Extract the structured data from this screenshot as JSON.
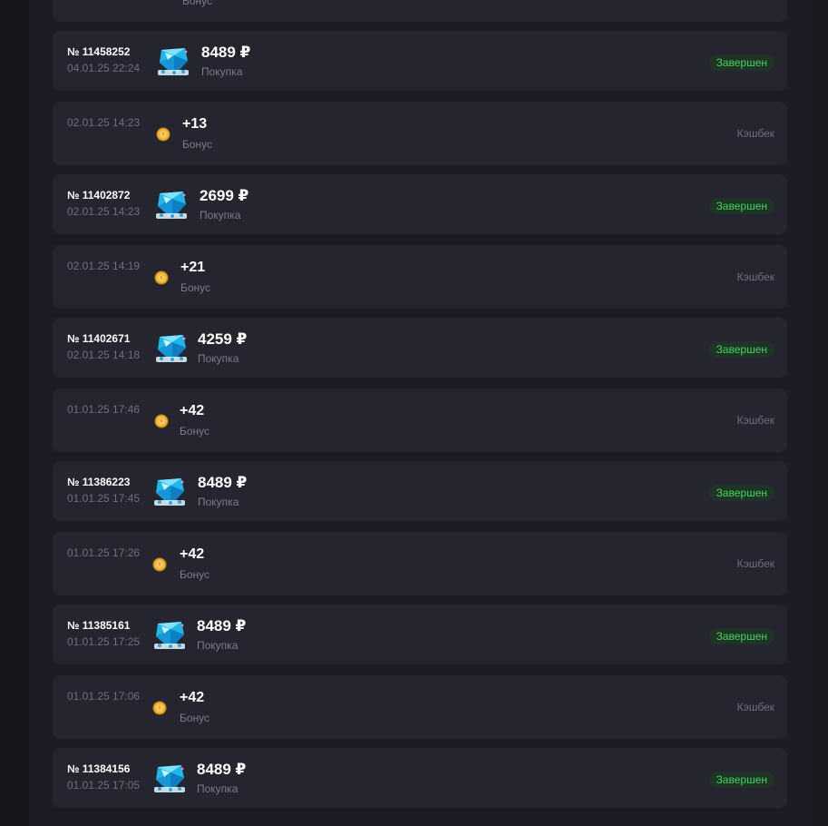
{
  "top_partial": {
    "label": "Бонус"
  },
  "rows": [
    {
      "kind": "purchase",
      "order": "№ 11458252",
      "date": "04.01.25 22:24",
      "amount": "8489 ₽",
      "label": "Покупка",
      "status": "Завершен",
      "icon": "gem-pack-icon"
    },
    {
      "kind": "bonus",
      "date": "02.01.25 14:23",
      "amount": "+13",
      "label": "Бонус",
      "status": "Кэшбек",
      "icon": "coin-icon"
    },
    {
      "kind": "purchase",
      "order": "№ 11402872",
      "date": "02.01.25 14:23",
      "amount": "2699 ₽",
      "label": "Покупка",
      "status": "Завершен",
      "icon": "gem-pack-icon"
    },
    {
      "kind": "bonus",
      "date": "02.01.25 14:19",
      "amount": "+21",
      "label": "Бонус",
      "status": "Кэшбек",
      "icon": "coin-icon"
    },
    {
      "kind": "purchase",
      "order": "№ 11402671",
      "date": "02.01.25 14:18",
      "amount": "4259 ₽",
      "label": "Покупка",
      "status": "Завершен",
      "icon": "gem-pack-icon"
    },
    {
      "kind": "bonus",
      "date": "01.01.25 17:46",
      "amount": "+42",
      "label": "Бонус",
      "status": "Кэшбек",
      "icon": "coin-icon"
    },
    {
      "kind": "purchase",
      "order": "№ 11386223",
      "date": "01.01.25 17:45",
      "amount": "8489 ₽",
      "label": "Покупка",
      "status": "Завершен",
      "icon": "gem-pack-icon"
    },
    {
      "kind": "bonus",
      "date": "01.01.25 17:26",
      "amount": "+42",
      "label": "Бонус",
      "status": "Кэшбек",
      "icon": "coin-icon"
    },
    {
      "kind": "purchase",
      "order": "№ 11385161",
      "date": "01.01.25 17:25",
      "amount": "8489 ₽",
      "label": "Покупка",
      "status": "Завершен",
      "icon": "gem-pack-icon"
    },
    {
      "kind": "bonus",
      "date": "01.01.25 17:06",
      "amount": "+42",
      "label": "Бонус",
      "status": "Кэшбек",
      "icon": "coin-icon"
    },
    {
      "kind": "purchase",
      "order": "№ 11384156",
      "date": "01.01.25 17:05",
      "amount": "8489 ₽",
      "label": "Покупка",
      "status": "Завершен",
      "icon": "gem-pack-icon"
    }
  ],
  "colors": {
    "completed": "#3ed45e",
    "badge_bg": "#1f3326",
    "row_bg": "#25252f"
  }
}
